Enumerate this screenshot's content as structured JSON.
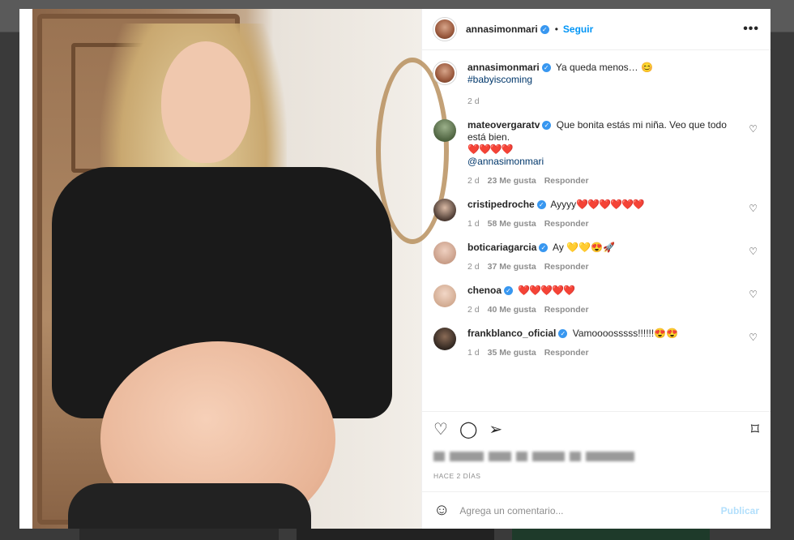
{
  "post": {
    "author": "annasimonmari",
    "follow_label": "Seguir",
    "more_label": "•••",
    "caption": "Ya queda menos… 😊",
    "hashtag": "#babyiscoming",
    "caption_age": "2 d",
    "posted_label": "HACE 2 DÍAS"
  },
  "comments": [
    {
      "user": "mateovergaratv",
      "text": "Que bonita estás mi niña. Veo que todo está bien.",
      "emoji": "❤️❤️❤️❤️",
      "mention": "@annasimonmari",
      "age": "2 d",
      "likes": "23 Me gusta",
      "reply": "Responder"
    },
    {
      "user": "cristipedroche",
      "text": "Ayyyy",
      "emoji": "❤️❤️❤️❤️❤️❤️",
      "age": "1 d",
      "likes": "58 Me gusta",
      "reply": "Responder"
    },
    {
      "user": "boticariagarcia",
      "text": "Ay",
      "emoji": "💛💛😍🚀",
      "age": "2 d",
      "likes": "37 Me gusta",
      "reply": "Responder"
    },
    {
      "user": "chenoa",
      "text": "",
      "emoji": "❤️❤️❤️❤️❤️",
      "age": "2 d",
      "likes": "40 Me gusta",
      "reply": "Responder"
    },
    {
      "user": "frankblanco_oficial",
      "text": "Vamoooosssss!!!!!!",
      "emoji": "😍😍",
      "age": "1 d",
      "likes": "35 Me gusta",
      "reply": "Responder"
    }
  ],
  "composer": {
    "placeholder": "Agrega un comentario...",
    "publish_label": "Publicar"
  },
  "icons": {
    "like": "heart-icon",
    "comment": "comment-icon",
    "share": "share-icon",
    "save": "bookmark-icon",
    "emoji": "emoji-icon",
    "verified": "verified-badge-icon"
  },
  "colors": {
    "accent": "#0095f6",
    "verified": "#3897f0",
    "publish_disabled": "#b2dffc"
  }
}
